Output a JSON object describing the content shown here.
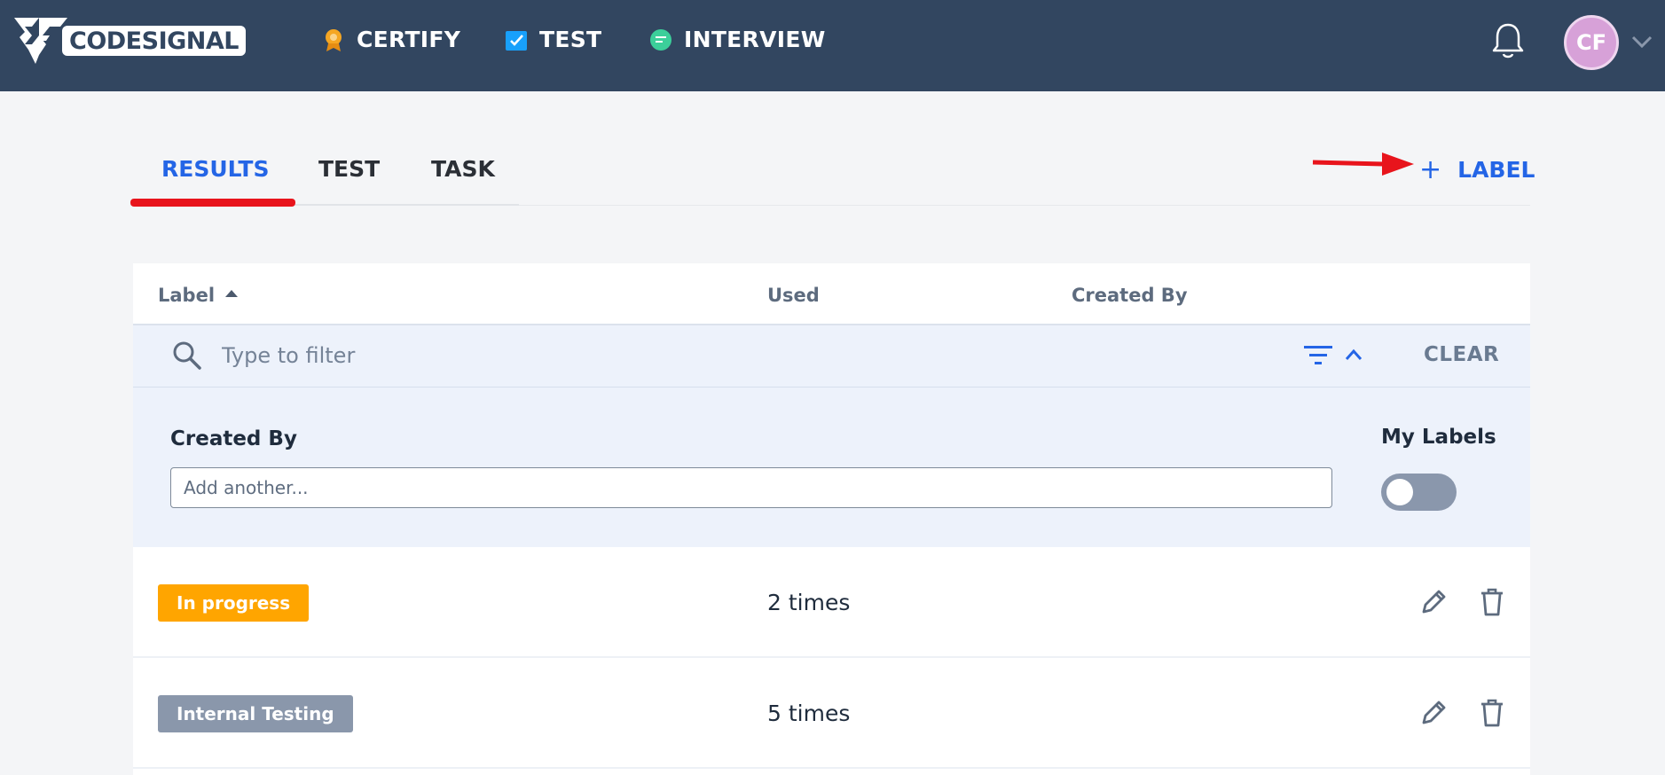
{
  "brand": {
    "name": "CODESIGNAL"
  },
  "nav": [
    {
      "label": "CERTIFY",
      "icon": "certify-medal-icon",
      "color": "#f5a623"
    },
    {
      "label": "TEST",
      "icon": "test-checkbox-icon",
      "color": "#18a0fb"
    },
    {
      "label": "INTERVIEW",
      "icon": "interview-chat-icon",
      "color": "#3ccf9a"
    }
  ],
  "user": {
    "initials": "CF"
  },
  "tabs": [
    {
      "label": "RESULTS",
      "active": true
    },
    {
      "label": "TEST",
      "active": false
    },
    {
      "label": "TASK",
      "active": false
    }
  ],
  "actions": {
    "add_plus": "+",
    "add_label": "LABEL"
  },
  "table": {
    "columns": {
      "label": "Label",
      "used": "Used",
      "created_by": "Created By"
    },
    "filter": {
      "placeholder": "Type to filter",
      "clear": "CLEAR"
    },
    "filter_panel": {
      "created_by_label": "Created By",
      "created_by_placeholder": "Add another...",
      "my_labels_label": "My Labels",
      "my_labels_on": false
    },
    "rows": [
      {
        "label": "In progress",
        "color": "#ffa500",
        "used": "2 times"
      },
      {
        "label": "Internal Testing",
        "color": "#8a97ab",
        "used": "5 times"
      }
    ]
  },
  "colors": {
    "topbar": "#324660",
    "accent": "#2465e6",
    "annotation": "#e8141c"
  }
}
